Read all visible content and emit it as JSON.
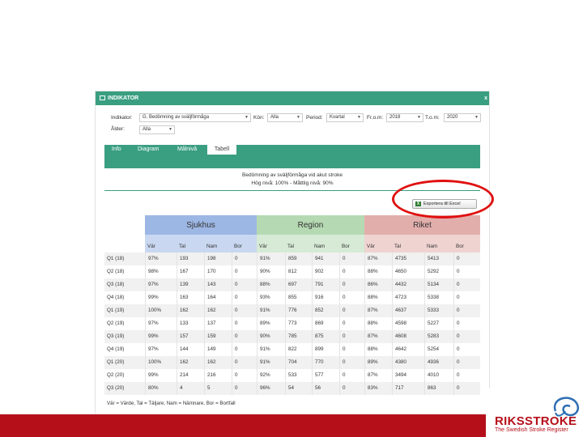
{
  "window": {
    "title": "INDIKATOR",
    "close": "x"
  },
  "filters": {
    "indikator": {
      "label": "Indikator:",
      "value": "G. Bedömning av sväljförmåga"
    },
    "kon": {
      "label": "Kön:",
      "value": "Alla"
    },
    "period": {
      "label": "Period:",
      "value": "Kvartal"
    },
    "from": {
      "label": "Fr.o.m:",
      "value": "2018"
    },
    "tom": {
      "label": "T.o.m:",
      "value": "2020"
    },
    "alder": {
      "label": "Ålder:",
      "value": "Alla"
    }
  },
  "tabs": [
    {
      "label": "Info"
    },
    {
      "label": "Diagram"
    },
    {
      "label": "Målnivå"
    },
    {
      "label": "Tabell",
      "active": true
    }
  ],
  "table_title": "Bedömning av sväljförmåga vid akut stroke",
  "table_subtitle": "Hög nivå: 100% - Måttlig nivå: 90%",
  "export_button": "Exportera till Excel",
  "groups": [
    {
      "name": "Sjukhus",
      "color": "#9db7e4"
    },
    {
      "name": "Region",
      "color": "#b5d9b2"
    },
    {
      "name": "Riket",
      "color": "#e2aeac"
    }
  ],
  "column_headers": [
    "Vär",
    "Tal",
    "Nam",
    "Bor"
  ],
  "rows": [
    {
      "label": "Q1 (18)",
      "values": [
        "97%",
        "193",
        "198",
        "0",
        "91%",
        "859",
        "941",
        "0",
        "87%",
        "4735",
        "5413",
        "0"
      ]
    },
    {
      "label": "Q2 (18)",
      "values": [
        "98%",
        "167",
        "170",
        "0",
        "90%",
        "812",
        "902",
        "0",
        "88%",
        "4650",
        "5292",
        "0"
      ]
    },
    {
      "label": "Q3 (18)",
      "values": [
        "97%",
        "139",
        "143",
        "0",
        "88%",
        "697",
        "791",
        "0",
        "86%",
        "4432",
        "5134",
        "0"
      ]
    },
    {
      "label": "Q4 (18)",
      "values": [
        "99%",
        "163",
        "164",
        "0",
        "93%",
        "855",
        "916",
        "0",
        "88%",
        "4723",
        "5338",
        "0"
      ]
    },
    {
      "label": "Q1 (19)",
      "values": [
        "100%",
        "162",
        "162",
        "0",
        "91%",
        "776",
        "852",
        "0",
        "87%",
        "4637",
        "5333",
        "0"
      ]
    },
    {
      "label": "Q2 (19)",
      "values": [
        "97%",
        "133",
        "137",
        "0",
        "89%",
        "773",
        "869",
        "0",
        "88%",
        "4598",
        "5227",
        "0"
      ]
    },
    {
      "label": "Q3 (19)",
      "values": [
        "99%",
        "157",
        "159",
        "0",
        "90%",
        "785",
        "875",
        "0",
        "87%",
        "4608",
        "5283",
        "0"
      ]
    },
    {
      "label": "Q4 (19)",
      "values": [
        "97%",
        "144",
        "149",
        "0",
        "91%",
        "822",
        "899",
        "0",
        "88%",
        "4642",
        "5254",
        "0"
      ]
    },
    {
      "label": "Q1 (20)",
      "values": [
        "100%",
        "162",
        "162",
        "0",
        "91%",
        "704",
        "770",
        "0",
        "89%",
        "4380",
        "4936",
        "0"
      ]
    },
    {
      "label": "Q2 (20)",
      "values": [
        "99%",
        "214",
        "216",
        "0",
        "92%",
        "533",
        "577",
        "0",
        "87%",
        "3494",
        "4010",
        "0"
      ]
    },
    {
      "label": "Q3 (20)",
      "values": [
        "80%",
        "4",
        "5",
        "0",
        "96%",
        "54",
        "56",
        "0",
        "83%",
        "717",
        "863",
        "0"
      ]
    }
  ],
  "footnote": "Vär = Värde, Tal = Täljare, Nam = Nämnare, Bor = Bortfall",
  "logo": {
    "name": "RIKSSTROKE",
    "tagline": "The Swedish Stroke Register"
  },
  "colors": {
    "accent": "#3a9e80",
    "footer": "#b5101a",
    "highlight": "#e01010"
  }
}
